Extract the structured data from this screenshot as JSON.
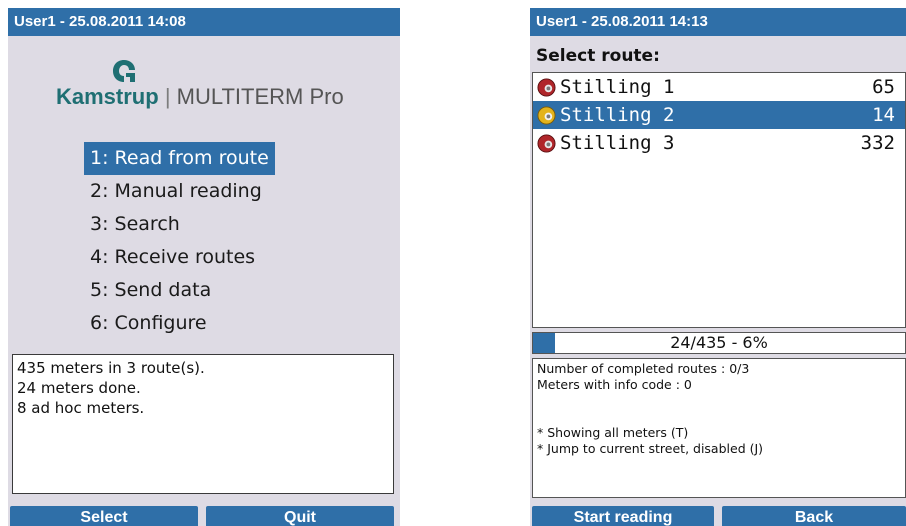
{
  "left_screen": {
    "title": "User1 - 25.08.2011 14:08",
    "logo": {
      "brand": "Kamstrup",
      "separator": "|",
      "product": "MULTITERM Pro"
    },
    "menu": [
      {
        "label": "1: Read from route",
        "selected": true
      },
      {
        "label": "2: Manual reading",
        "selected": false
      },
      {
        "label": "3: Search",
        "selected": false
      },
      {
        "label": "4: Receive routes",
        "selected": false
      },
      {
        "label": "5: Send data",
        "selected": false
      },
      {
        "label": "6: Configure",
        "selected": false
      }
    ],
    "info_lines": [
      "435 meters in 3 route(s).",
      "24 meters done.",
      "8 ad hoc meters."
    ],
    "softkeys": {
      "left": "Select",
      "right": "Quit"
    }
  },
  "right_screen": {
    "title": "User1 - 25.08.2011 14:13",
    "heading": "Select route:",
    "routes": [
      {
        "name": "Stilling 1",
        "count": "65",
        "icon": "red-status-icon",
        "selected": false
      },
      {
        "name": "Stilling 2",
        "count": "14",
        "icon": "yellow-status-icon",
        "selected": true
      },
      {
        "name": "Stilling 3",
        "count": "332",
        "icon": "red-status-icon",
        "selected": false
      }
    ],
    "progress": {
      "label": "24/435 - 6%",
      "percent": 6
    },
    "status_lines": [
      "Number of completed routes : 0/3",
      "Meters with info code : 0"
    ],
    "notes": [
      "* Showing all meters (T)",
      "* Jump to current street, disabled (J)"
    ],
    "softkeys": {
      "left": "Start reading",
      "right": "Back"
    }
  },
  "colors": {
    "accent": "#2f6fa8",
    "screen_bg": "#dedbe4",
    "logo_teal": "#1f6f73",
    "red_icon": "#b0262a",
    "yellow_icon": "#e3b31c"
  }
}
